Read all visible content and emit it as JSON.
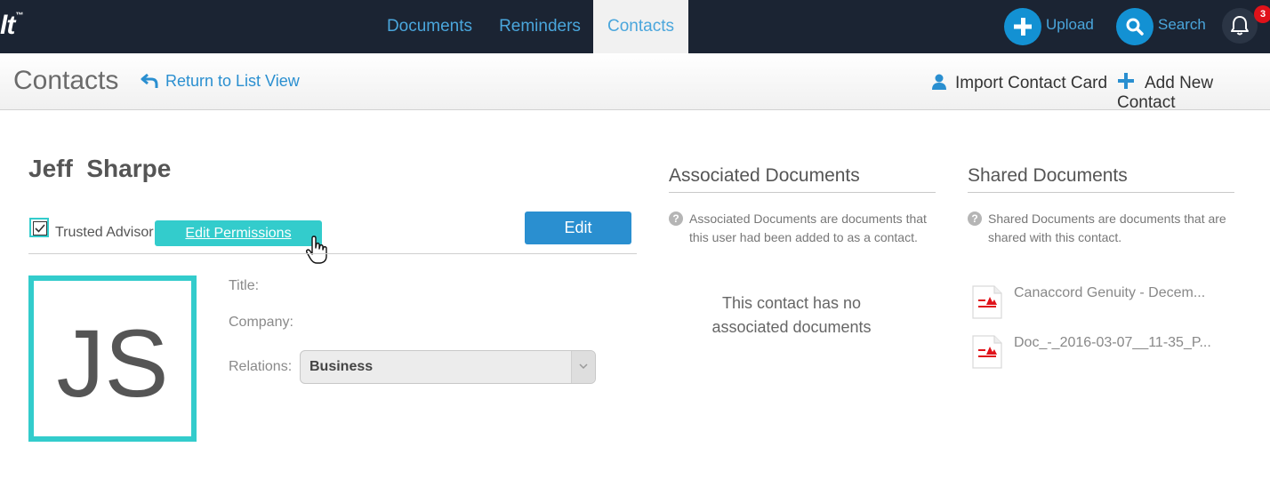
{
  "app": {
    "logo_text": "lt",
    "logo_tm": "™"
  },
  "nav": {
    "tabs": [
      {
        "label": "Documents"
      },
      {
        "label": "Reminders"
      },
      {
        "label": "Contacts"
      }
    ],
    "upload_label": "Upload",
    "search_label": "Search",
    "notification_count": "3"
  },
  "subheader": {
    "title": "Contacts",
    "return_label": "Return to List View",
    "import_label": "Import Contact Card",
    "add_label": "Add New Contact"
  },
  "contact": {
    "name": "Jeff  Sharpe",
    "trusted_label": "Trusted Advisor",
    "trusted_checked": true,
    "edit_permissions_label": "Edit Permissions",
    "edit_label": "Edit",
    "initials": "JS",
    "title_label": "Title:",
    "company_label": "Company:",
    "relations_label": "Relations:",
    "relations_value": "Business"
  },
  "associated": {
    "title": "Associated Documents",
    "help_line1": "Associated Documents are documents that",
    "help_line2": "this user had been added to as a contact.",
    "empty_line1": "This contact has no",
    "empty_line2": "associated documents"
  },
  "shared": {
    "title": "Shared Documents",
    "help_line1": "Shared Documents are documents that are",
    "help_line2": "shared with this contact.",
    "documents": [
      {
        "name": "Canaccord Genuity - Decem..."
      },
      {
        "name": "Doc_-_2016-03-07__11-35_P..."
      }
    ]
  },
  "colors": {
    "nav_bg": "#1b2433",
    "accent_blue": "#2a8fd0",
    "accent_teal": "#33cccc",
    "badge_red": "#e0121a"
  }
}
